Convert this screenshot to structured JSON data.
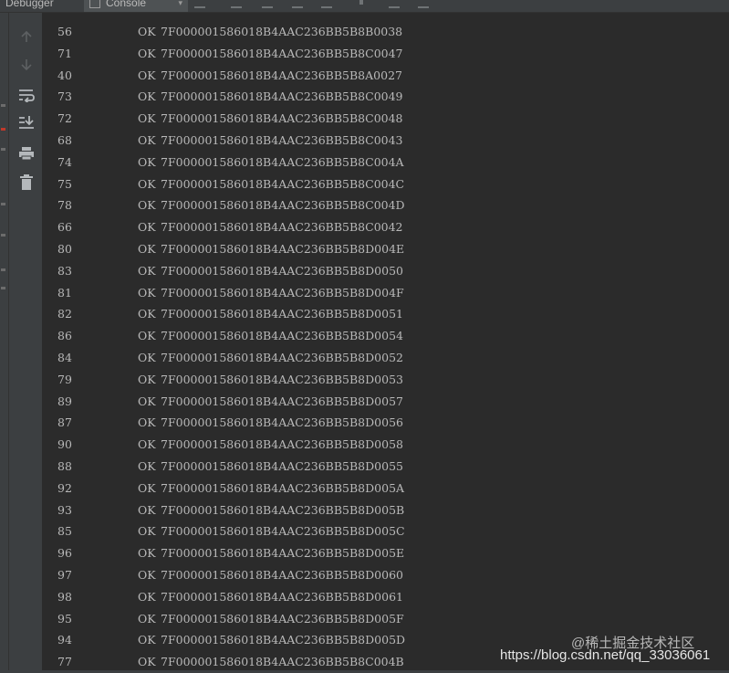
{
  "tabs": {
    "debugger_label": "Debugger",
    "console_label": "Console"
  },
  "toolbar_icons": [
    "up-arrow-icon",
    "down-arrow-icon",
    "soft-wrap-icon",
    "scroll-to-end-icon",
    "print-icon",
    "clear-all-icon"
  ],
  "rows": [
    {
      "index": "56",
      "status": "OK",
      "hex": "7F000001586018B4AAC236BB5B8B0038"
    },
    {
      "index": "71",
      "status": "OK",
      "hex": "7F000001586018B4AAC236BB5B8C0047"
    },
    {
      "index": "40",
      "status": "OK",
      "hex": "7F000001586018B4AAC236BB5B8A0027"
    },
    {
      "index": "73",
      "status": "OK",
      "hex": "7F000001586018B4AAC236BB5B8C0049"
    },
    {
      "index": "72",
      "status": "OK",
      "hex": "7F000001586018B4AAC236BB5B8C0048"
    },
    {
      "index": "68",
      "status": "OK",
      "hex": "7F000001586018B4AAC236BB5B8C0043"
    },
    {
      "index": "74",
      "status": "OK",
      "hex": "7F000001586018B4AAC236BB5B8C004A"
    },
    {
      "index": "75",
      "status": "OK",
      "hex": "7F000001586018B4AAC236BB5B8C004C"
    },
    {
      "index": "78",
      "status": "OK",
      "hex": "7F000001586018B4AAC236BB5B8C004D"
    },
    {
      "index": "66",
      "status": "OK",
      "hex": "7F000001586018B4AAC236BB5B8C0042"
    },
    {
      "index": "80",
      "status": "OK",
      "hex": "7F000001586018B4AAC236BB5B8D004E"
    },
    {
      "index": "83",
      "status": "OK",
      "hex": "7F000001586018B4AAC236BB5B8D0050"
    },
    {
      "index": "81",
      "status": "OK",
      "hex": "7F000001586018B4AAC236BB5B8D004F"
    },
    {
      "index": "82",
      "status": "OK",
      "hex": "7F000001586018B4AAC236BB5B8D0051"
    },
    {
      "index": "86",
      "status": "OK",
      "hex": "7F000001586018B4AAC236BB5B8D0054"
    },
    {
      "index": "84",
      "status": "OK",
      "hex": "7F000001586018B4AAC236BB5B8D0052"
    },
    {
      "index": "79",
      "status": "OK",
      "hex": "7F000001586018B4AAC236BB5B8D0053"
    },
    {
      "index": "89",
      "status": "OK",
      "hex": "7F000001586018B4AAC236BB5B8D0057"
    },
    {
      "index": "87",
      "status": "OK",
      "hex": "7F000001586018B4AAC236BB5B8D0056"
    },
    {
      "index": "90",
      "status": "OK",
      "hex": "7F000001586018B4AAC236BB5B8D0058"
    },
    {
      "index": "88",
      "status": "OK",
      "hex": "7F000001586018B4AAC236BB5B8D0055"
    },
    {
      "index": "92",
      "status": "OK",
      "hex": "7F000001586018B4AAC236BB5B8D005A"
    },
    {
      "index": "93",
      "status": "OK",
      "hex": "7F000001586018B4AAC236BB5B8D005B"
    },
    {
      "index": "85",
      "status": "OK",
      "hex": "7F000001586018B4AAC236BB5B8D005C"
    },
    {
      "index": "96",
      "status": "OK",
      "hex": "7F000001586018B4AAC236BB5B8D005E"
    },
    {
      "index": "97",
      "status": "OK",
      "hex": "7F000001586018B4AAC236BB5B8D0060"
    },
    {
      "index": "98",
      "status": "OK",
      "hex": "7F000001586018B4AAC236BB5B8D0061"
    },
    {
      "index": "95",
      "status": "OK",
      "hex": "7F000001586018B4AAC236BB5B8D005F"
    },
    {
      "index": "94",
      "status": "OK",
      "hex": "7F000001586018B4AAC236BB5B8D005D"
    },
    {
      "index": "77",
      "status": "OK",
      "hex": "7F000001586018B4AAC236BB5B8C004B"
    }
  ],
  "watermark": {
    "line1": "@稀土掘金技术社区",
    "line2": "https://blog.csdn.net/qq_33036061"
  },
  "colors": {
    "background": "#2b2b2b",
    "panel": "#3c3f41",
    "text": "#b9b9b9"
  }
}
